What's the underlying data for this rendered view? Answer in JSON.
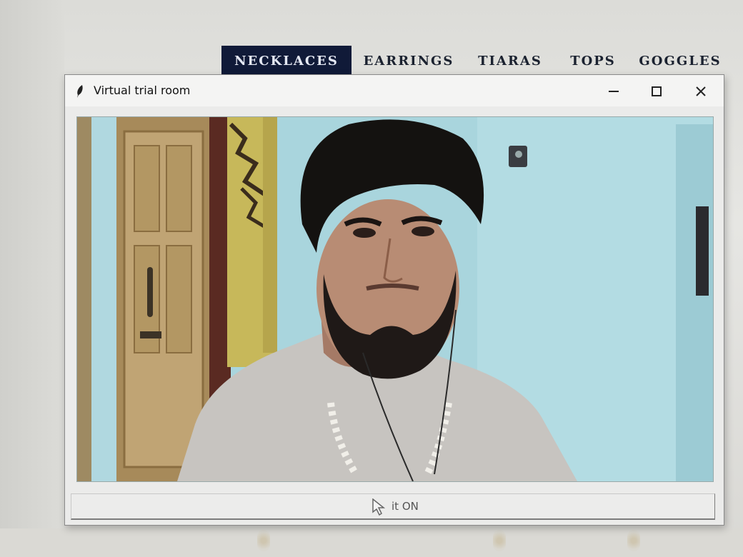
{
  "website_nav": {
    "items": [
      {
        "label": "NECKLACES",
        "active": true
      },
      {
        "label": "EARRINGS",
        "active": false
      },
      {
        "label": "TIARAS",
        "active": false
      },
      {
        "label": "TOPS",
        "active": false
      },
      {
        "label": "GOGGLES",
        "active": false
      }
    ]
  },
  "window": {
    "title": "Virtual trial room",
    "app_icon": "feather-icon",
    "controls": [
      "minimize-icon",
      "maximize-icon",
      "close-icon"
    ]
  },
  "video_feed": {
    "content": "webcam-feed"
  },
  "bottom_button": {
    "label": "it ON"
  },
  "colors": {
    "nav_active_bg": "#101a38",
    "window_bg": "#ebebea",
    "video_wall": "#a8d6de"
  }
}
